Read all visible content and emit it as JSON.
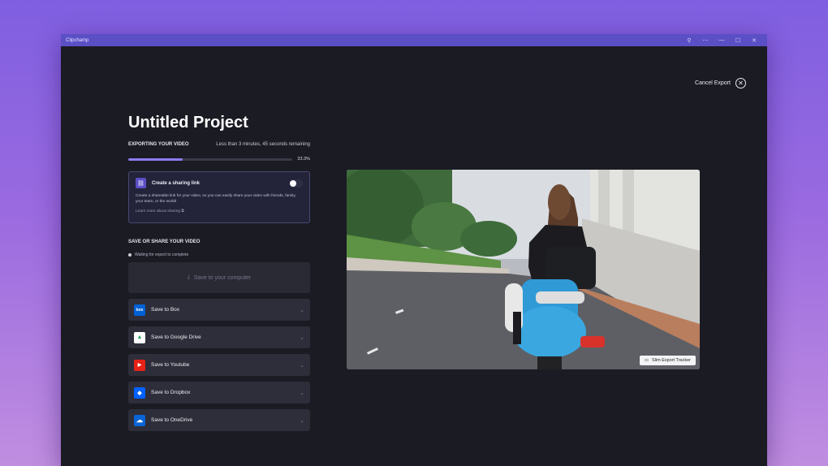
{
  "window": {
    "app_name": "Clipchamp",
    "controls": {
      "pin": "⚲",
      "menu": "⋯",
      "minimize": "—",
      "maximize": "☐",
      "close": "✕"
    }
  },
  "header": {
    "cancel_label": "Cancel Export"
  },
  "project": {
    "title": "Untitled Project"
  },
  "export": {
    "label": "EXPORTING YOUR VIDEO",
    "remaining": "Less than 3 minutes, 45 seconds remaining",
    "progress_percent": 33.3,
    "progress_text": "33.3%"
  },
  "share": {
    "title": "Create a sharing link",
    "description": "Create a shareable link for your video, so you can easily share your video with friends, family, your team, or the world!",
    "link_text": "Learn more about sharing",
    "toggle_on": false
  },
  "save": {
    "section_title": "SAVE OR SHARE YOUR VIDEO",
    "waiting_text": "Waiting for export to complete",
    "computer_label": "Save to your computer",
    "destinations": [
      {
        "label": "Save to Box",
        "logo": "box",
        "color": "#0061d5"
      },
      {
        "label": "Save to Google Drive",
        "logo": "▲",
        "color": "#ffffff"
      },
      {
        "label": "Save to Youtube",
        "logo": "▶",
        "color": "#e62117"
      },
      {
        "label": "Save to Dropbox",
        "logo": "◆",
        "color": "#0061fe"
      },
      {
        "label": "Save to OneDrive",
        "logo": "☁",
        "color": "#0a64d6"
      }
    ]
  },
  "preview": {
    "badge_label": "Slim Export Tracker"
  },
  "colors": {
    "accent": "#5b4fc6",
    "progress": "#8b7cf0",
    "toggle_off": "#2f2f45"
  }
}
